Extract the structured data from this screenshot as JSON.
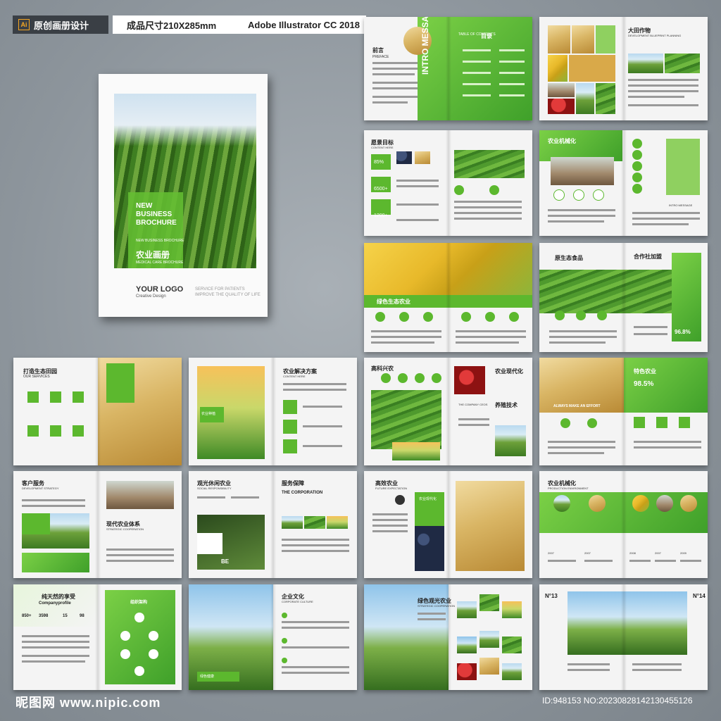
{
  "topbar": {
    "ai_icon": "Ai",
    "label1": "原创画册设计",
    "label2": "成品尺寸210X285mm",
    "label3": "Adobe Illustrator CC 2018"
  },
  "cover": {
    "title": "NEW\nBUSINESS\nBROCHURE",
    "subtitle": "NEW BUSINESS BROCHURE",
    "cn_title": "农业画册",
    "sub2": "MEDICAL CARE BROCHURE",
    "logo": "YOUR LOGO",
    "logo_sub": "Creative Design",
    "slogan": "SERVICE FOR PATIENTS\nIMPROVE THE QUALITY OF LIFE"
  },
  "spreads": {
    "s1": {
      "title": "前言",
      "sub": "PREFACE",
      "vertical": "INTRO MESSAGE",
      "toc": "目录",
      "toc_sub": "TABLE OF CONTENTS"
    },
    "s2": {
      "title": "大田作物",
      "sub": "DEVELOPMENT BLUEPRINT PLANNING"
    },
    "s3": {
      "title": "愿景目标",
      "sub": "CONTENT HERE",
      "stat1": "85%",
      "stat2": "6500+",
      "stat3": "1200+"
    },
    "s4": {
      "title": "农业机械化",
      "sub": "INTRO MESSAGE"
    },
    "s5": {
      "banner": "绿色生态农业"
    },
    "s6": {
      "title": "原生态食品",
      "title2": "合作社加盟",
      "stat": "96.8%"
    },
    "s7": {
      "title": "打造生态田园",
      "sub": "OUR SERVICES"
    },
    "s8": {
      "title": "农业解决方案",
      "sub": "CONTENT HERE",
      "caption": "农业种植"
    },
    "s9": {
      "title": "高科兴农",
      "title2": "农业现代化",
      "title3": "养殖技术",
      "sub": "THE COMPANY CEOS"
    },
    "s10": {
      "title": "特色农业",
      "stat": "98.5%",
      "banner": "ALWAYS MAKE AN EFFORT"
    },
    "s11": {
      "title": "客户服务",
      "sub": "DEVELOPMENT STRATEGY",
      "title2": "现代农业体系",
      "sub2": "STRATEGIC COOPERATION"
    },
    "s12": {
      "title": "观光休闲农业",
      "sub": "SOCIAL RESPONSIBILITY",
      "title2": "服务保障",
      "sub2": "THE CORPORATION",
      "badge": "BE"
    },
    "s13": {
      "title": "高效农业",
      "sub": "FUTURE EXPECTATION",
      "title2": "农业现代化"
    },
    "s14": {
      "title": "农业机械化",
      "sub": "PRODUCTION ENVIRONMENT",
      "years": [
        "2007",
        "2007",
        "2008",
        "2007",
        "2009"
      ]
    },
    "s15": {
      "title": "纯天然的享受",
      "sub": "Companyprofile",
      "stats": [
        "850+",
        "3598",
        "15",
        "98"
      ],
      "title2": "组织架构"
    },
    "s16": {
      "title": "企业文化",
      "sub": "CORPORATE CULTURE",
      "caption": "绿色健康"
    },
    "s17": {
      "title": "绿色观光农业",
      "sub": "STRATEGIC COOPERATION"
    },
    "s18": {
      "num1": "N°13",
      "num2": "N°14"
    }
  },
  "footer": {
    "watermark": "昵图网 www.nipic.com",
    "id": "ID:948153 NO:20230828142130455126"
  }
}
